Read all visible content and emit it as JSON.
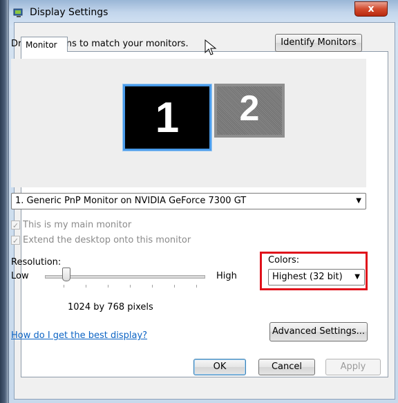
{
  "window": {
    "title": "Display Settings",
    "close_glyph": "x"
  },
  "tabs": [
    {
      "label": "Monitor"
    }
  ],
  "instructions": "Drag the icons to match your monitors.",
  "identify_button": "Identify Monitors",
  "monitors": [
    {
      "number": "1",
      "selected": true
    },
    {
      "number": "2",
      "selected": false
    }
  ],
  "monitor_select": {
    "value": "1. Generic PnP Monitor on NVIDIA GeForce 7300 GT"
  },
  "checkboxes": {
    "main_monitor": "This is my main monitor",
    "extend_desktop": "Extend the desktop onto this monitor"
  },
  "resolution": {
    "label": "Resolution:",
    "low": "Low",
    "high": "High",
    "value": "1024 by 768 pixels"
  },
  "colors": {
    "label": "Colors:",
    "value": "Highest (32 bit)",
    "highlight_color": "#e0101a"
  },
  "help_link": "How do I get the best display?",
  "advanced_button": "Advanced Settings...",
  "footer": {
    "ok": "OK",
    "cancel": "Cancel",
    "apply": "Apply"
  },
  "icons": [
    "display-settings-icon",
    "close-icon",
    "dropdown-arrow-icon",
    "mouse-cursor-icon"
  ]
}
